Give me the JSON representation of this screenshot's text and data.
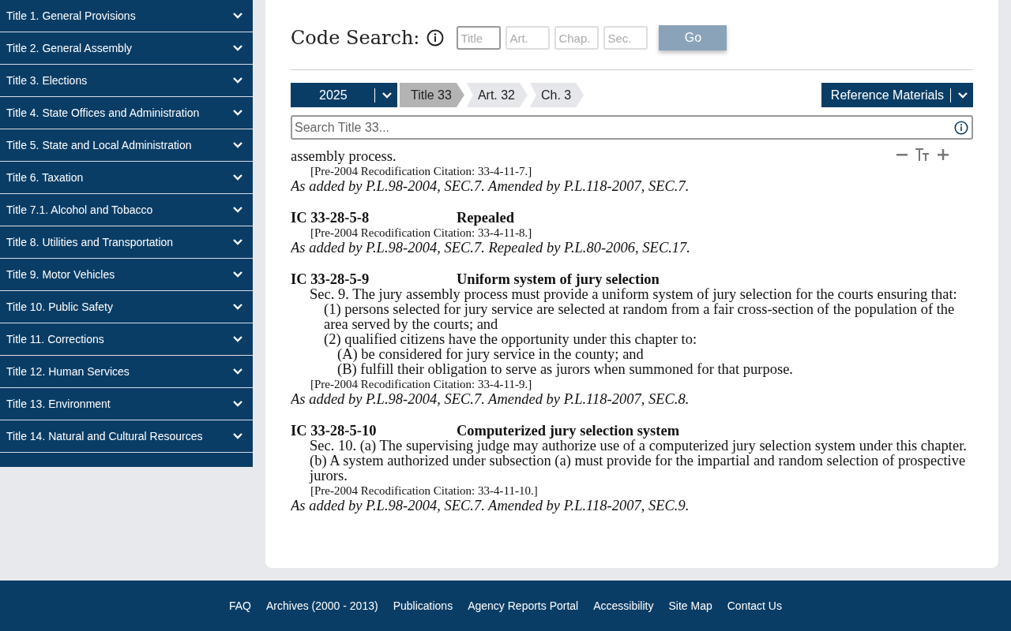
{
  "sidebar": {
    "items": [
      {
        "label": "Title 1. General Provisions",
        "expanded": false
      },
      {
        "label": "Title 2. General Assembly",
        "expanded": false
      },
      {
        "label": "Title 3. Elections",
        "expanded": false
      },
      {
        "label": "Title 4. State Offices and Administration",
        "expanded": false
      },
      {
        "label": "Title 5. State and Local Administration",
        "expanded": false
      },
      {
        "label": "Title 6. Taxation",
        "expanded": false
      },
      {
        "label": "Title 7.1. Alcohol and Tobacco",
        "expanded": false
      },
      {
        "label": "Title 8. Utilities and Transportation",
        "expanded": false
      },
      {
        "label": "Title 9. Motor Vehicles",
        "expanded": false
      },
      {
        "label": "Title 10. Public Safety",
        "expanded": false
      },
      {
        "label": "Title 11. Corrections",
        "expanded": false
      },
      {
        "label": "Title 12. Human Services",
        "expanded": false
      },
      {
        "label": "Title 13. Environment",
        "expanded": false
      },
      {
        "label": "Title 14. Natural and Cultural Resources",
        "expanded": false
      }
    ]
  },
  "code_search": {
    "label": "Code Search:",
    "fields": [
      {
        "placeholder": "Title",
        "focused": true
      },
      {
        "placeholder": "Art.",
        "focused": false
      },
      {
        "placeholder": "Chap.",
        "focused": false
      },
      {
        "placeholder": "Sec.",
        "focused": false
      }
    ],
    "button": "Go"
  },
  "year_select": {
    "value": "2025"
  },
  "breadcrumbs": [
    {
      "label": "Title 33",
      "selected": true
    },
    {
      "label": "Art. 32",
      "selected": false
    },
    {
      "label": "Ch. 3",
      "selected": false
    }
  ],
  "reference_menu": {
    "label": "Reference Materials"
  },
  "search": {
    "placeholder": "Search Title 33..."
  },
  "sections": [
    {
      "lines": [
        {
          "kind": "continuation",
          "text": "assembly process."
        },
        {
          "kind": "citation",
          "text": "[Pre-2004 Recodification Citation: 33-4-11-7.]"
        },
        {
          "kind": "history",
          "text": "As added by P.L.98-2004, SEC.7. Amended by P.L.118-2007, SEC.7."
        }
      ]
    },
    {
      "number": "IC 33-28-5-8",
      "heading": "Repealed",
      "lines": [
        {
          "kind": "citation",
          "text": "[Pre-2004 Recodification Citation: 33-4-11-8.]"
        },
        {
          "kind": "history",
          "text": "As added by P.L.98-2004, SEC.7. Repealed by P.L.80-2006, SEC.17."
        }
      ]
    },
    {
      "number": "IC 33-28-5-9",
      "heading": "Uniform system of jury selection",
      "lines": [
        {
          "kind": "paragraph",
          "text": "Sec. 9. The jury assembly process must provide a uniform system of jury selection for the courts ensuring that:"
        },
        {
          "kind": "clause",
          "text": "(1) persons selected for jury service are selected at random from a fair cross-section of the population of the area served by the courts; and"
        },
        {
          "kind": "clause",
          "text": "(2) qualified citizens have the opportunity under this chapter to:"
        },
        {
          "kind": "subclause",
          "text": "(A) be considered for jury service in the county; and"
        },
        {
          "kind": "subclause",
          "text": "(B) fulfill their obligation to serve as jurors when summoned for that purpose."
        },
        {
          "kind": "citation",
          "text": "[Pre-2004 Recodification Citation: 33-4-11-9.]"
        },
        {
          "kind": "history",
          "text": "As added by P.L.98-2004, SEC.7. Amended by P.L.118-2007, SEC.8."
        }
      ]
    },
    {
      "number": "IC 33-28-5-10",
      "heading": "Computerized jury selection system",
      "lines": [
        {
          "kind": "paragraph",
          "text": "Sec. 10. (a) The supervising judge may authorize use of a computerized jury selection system under this chapter."
        },
        {
          "kind": "paragraph",
          "text": "(b) A system authorized under subsection (a) must provide for the impartial and random selection of prospective jurors."
        },
        {
          "kind": "citation",
          "text": "[Pre-2004 Recodification Citation: 33-4-11-10.]"
        },
        {
          "kind": "history",
          "text": "As added by P.L.98-2004, SEC.7. Amended by P.L.118-2007, SEC.9."
        }
      ]
    }
  ],
  "footer": {
    "links": [
      "FAQ",
      "Archives (2000 - 2013)",
      "Publications",
      "Agency Reports Portal",
      "Accessibility",
      "Site Map",
      "Contact Us"
    ]
  }
}
